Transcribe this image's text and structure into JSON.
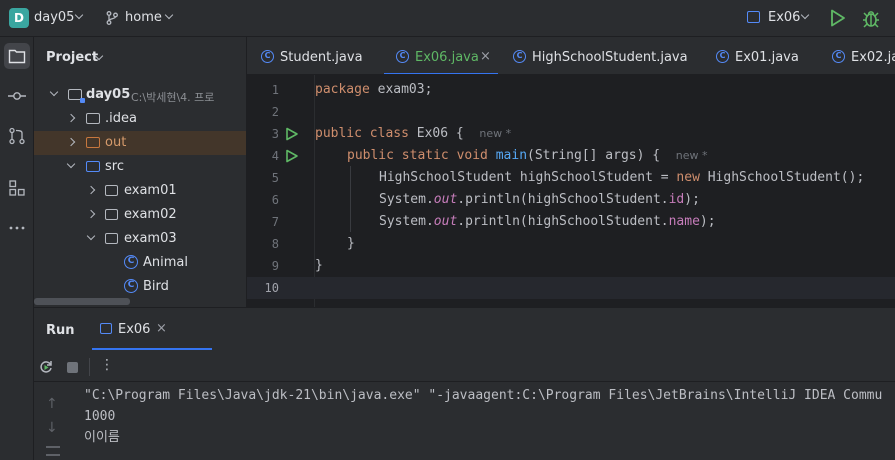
{
  "titlebar": {
    "project_badge": "D",
    "project_name": "day05",
    "branch": "home",
    "run_config": "Ex06"
  },
  "toolstrip": {
    "icons": [
      "folder-icon",
      "commit-icon",
      "pull-request-icon",
      "structure-icon",
      "more-icon"
    ]
  },
  "project_panel": {
    "title": "Project",
    "tree": [
      {
        "label": "day05",
        "path": "C:\\박세현\\4. 프로",
        "level": 0,
        "expanded": true,
        "kind": "module"
      },
      {
        "label": ".idea",
        "level": 1,
        "expanded": false,
        "kind": "folder"
      },
      {
        "label": "out",
        "level": 1,
        "expanded": false,
        "kind": "out"
      },
      {
        "label": "src",
        "level": 1,
        "expanded": true,
        "kind": "src"
      },
      {
        "label": "exam01",
        "level": 2,
        "expanded": false,
        "kind": "package"
      },
      {
        "label": "exam02",
        "level": 2,
        "expanded": false,
        "kind": "package"
      },
      {
        "label": "exam03",
        "level": 2,
        "expanded": true,
        "kind": "package"
      },
      {
        "label": "Animal",
        "level": 3,
        "kind": "class"
      },
      {
        "label": "Bird",
        "level": 3,
        "kind": "class"
      }
    ]
  },
  "editor": {
    "tabs": [
      {
        "label": "Student.java",
        "active": false
      },
      {
        "label": "Ex06.java",
        "active": true
      },
      {
        "label": "HighSchoolStudent.java",
        "active": false
      },
      {
        "label": "Ex01.java",
        "active": false
      },
      {
        "label": "Ex02.java",
        "active": false
      }
    ],
    "close_glyph": "×",
    "line_numbers": [
      "1",
      "2",
      "3",
      "4",
      "5",
      "6",
      "7",
      "8",
      "9",
      "10"
    ],
    "current_line": 10,
    "hints": {
      "class": "new *",
      "method": "new *"
    },
    "code": {
      "l1_kw": "package",
      "l1_rest": " exam03;",
      "l3_kw": "public class",
      "l3_rest": " Ex06 {",
      "l4_kw": "public static void",
      "l4_fn": "main",
      "l4_rest": "(String[] args) {",
      "l5_a": "HighSchoolStudent highSchoolStudent = ",
      "l5_kw": "new",
      "l5_b": " HighSchoolStudent();",
      "l6_a": "System.",
      "l6_out": "out",
      "l6_b": ".println(highSchoolStudent.",
      "l6_field": "id",
      "l6_c": ");",
      "l7_a": "System.",
      "l7_out": "out",
      "l7_b": ".println(highSchoolStudent.",
      "l7_field": "name",
      "l7_c": ");",
      "l8": "}",
      "l9": "}"
    }
  },
  "run_panel": {
    "title": "Run",
    "tab_label": "Ex06",
    "close_glyph": "×",
    "more_glyph": "⋮",
    "up_glyph": "↑",
    "down_glyph": "↓",
    "console": [
      "\"C:\\Program Files\\Java\\jdk-21\\bin\\java.exe\" \"-javaagent:C:\\Program Files\\JetBrains\\IntelliJ IDEA Commu",
      "1000",
      "이이름"
    ]
  }
}
